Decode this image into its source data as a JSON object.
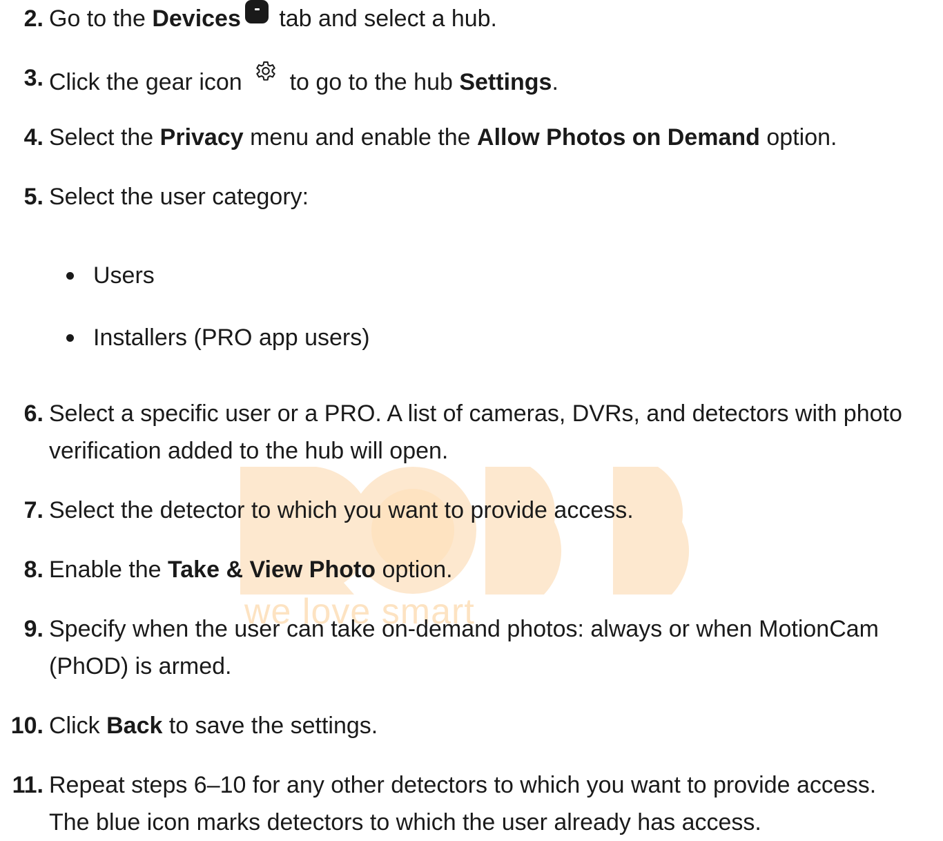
{
  "watermark": {
    "brand_text": "we love smart"
  },
  "steps": [
    {
      "number": "2.",
      "parts": [
        "Go to the ",
        "Devices",
        " tab and select a hub."
      ]
    },
    {
      "number": "3.",
      "parts": [
        "Click the gear icon ",
        " to go to the hub ",
        "Settings",
        "."
      ]
    },
    {
      "number": "4.",
      "parts": [
        "Select the ",
        "Privacy",
        " menu and enable the ",
        "Allow Photos on Demand",
        " option."
      ]
    },
    {
      "number": "5.",
      "parts": [
        "Select the user category:"
      ]
    },
    {
      "number": "6.",
      "lines": [
        "Select a specific user or a PRO. A list of cameras, DVRs, and detectors with photo",
        "verification added to the hub will open."
      ]
    },
    {
      "number": "7.",
      "parts": [
        "Select the detector to which you want to provide access."
      ]
    },
    {
      "number": "8.",
      "parts": [
        "Enable the ",
        "Take & View Photo",
        " option."
      ]
    },
    {
      "number": "9.",
      "lines": [
        "Specify when the user can take on-demand photos: always or when MotionCam",
        "(PhOD) is armed."
      ]
    },
    {
      "number": "10.",
      "parts": [
        "Click ",
        "Back",
        " to save the settings."
      ]
    },
    {
      "number": "11.",
      "lines": [
        "Repeat steps 6–10 for any other detectors to which you want to provide access.",
        "The blue icon marks detectors to which the user already has access."
      ]
    }
  ],
  "bullets": [
    "Users",
    "Installers (PRO app users)"
  ],
  "icons": {
    "devices": "devices-tab-icon",
    "gear": "gear-icon"
  }
}
